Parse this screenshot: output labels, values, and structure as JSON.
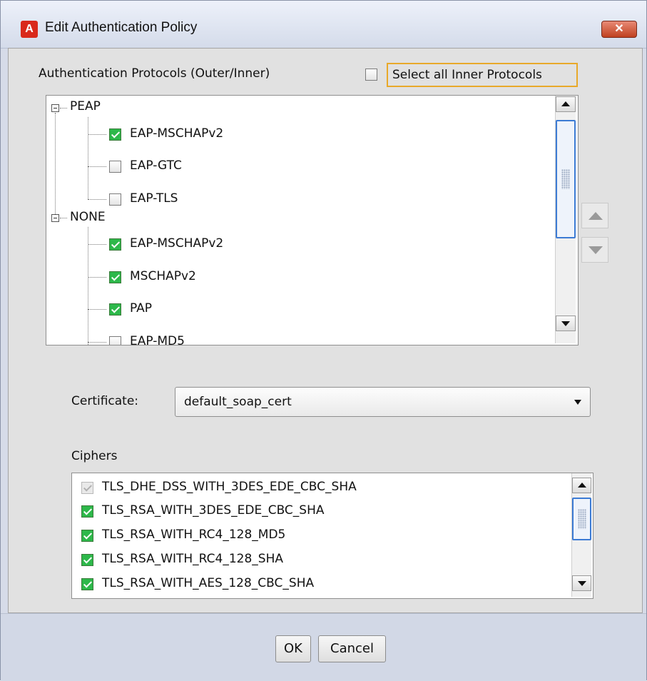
{
  "window": {
    "title": "Edit Authentication Policy",
    "app_icon_letter": "A",
    "close_glyph": "✕"
  },
  "protocols": {
    "label": "Authentication Protocols (Outer/Inner)",
    "select_all_label": "Select all Inner Protocols",
    "select_all_checked": false,
    "groups": [
      {
        "name": "PEAP",
        "expanded": true,
        "items": [
          {
            "label": "EAP-MSCHAPv2",
            "checked": true
          },
          {
            "label": "EAP-GTC",
            "checked": false
          },
          {
            "label": "EAP-TLS",
            "checked": false
          }
        ]
      },
      {
        "name": "NONE",
        "expanded": true,
        "items": [
          {
            "label": "EAP-MSCHAPv2",
            "checked": true
          },
          {
            "label": "MSCHAPv2",
            "checked": true
          },
          {
            "label": "PAP",
            "checked": true
          },
          {
            "label": "EAP-MD5",
            "checked": false
          }
        ]
      }
    ],
    "move_up_icon": "arrow-up-icon",
    "move_down_icon": "arrow-down-icon"
  },
  "certificate": {
    "label": "Certificate:",
    "value": "default_soap_cert"
  },
  "ciphers": {
    "label": "Ciphers",
    "items": [
      {
        "label": "TLS_DHE_DSS_WITH_3DES_EDE_CBC_SHA",
        "checked": true,
        "disabled": true
      },
      {
        "label": "TLS_RSA_WITH_3DES_EDE_CBC_SHA",
        "checked": true,
        "disabled": false
      },
      {
        "label": "TLS_RSA_WITH_RC4_128_MD5",
        "checked": true,
        "disabled": false
      },
      {
        "label": "TLS_RSA_WITH_RC4_128_SHA",
        "checked": true,
        "disabled": false
      },
      {
        "label": "TLS_RSA_WITH_AES_128_CBC_SHA",
        "checked": true,
        "disabled": false
      }
    ]
  },
  "buttons": {
    "ok": "OK",
    "cancel": "Cancel"
  },
  "colors": {
    "check_green": "#2db84a",
    "focus_orange": "#e8a92a",
    "scroll_thumb_blue": "#3c7bd4",
    "close_red": "#c0401f",
    "app_icon_red": "#d9291c"
  }
}
